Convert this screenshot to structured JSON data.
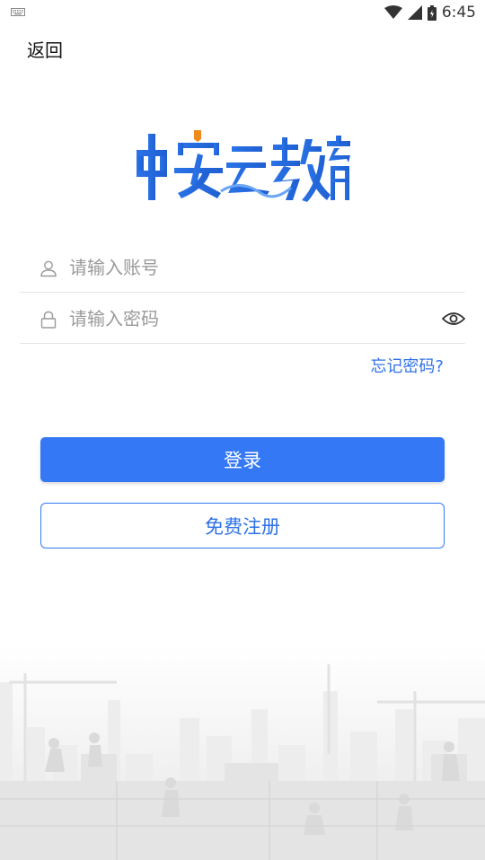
{
  "status_bar": {
    "time": "6:45"
  },
  "header": {
    "back_label": "返回"
  },
  "logo": {
    "text": "中安云教育",
    "brand_color": "#2f6fe4",
    "accent_color": "#f08a1c"
  },
  "form": {
    "account": {
      "placeholder": "请输入账号",
      "value": "",
      "icon": "user-icon"
    },
    "password": {
      "placeholder": "请输入密码",
      "value": "",
      "icon": "lock-icon",
      "toggle_icon": "eye-icon"
    },
    "forgot_label": "忘记密码?"
  },
  "buttons": {
    "login_label": "登录",
    "register_label": "免费注册"
  },
  "colors": {
    "primary": "#3478f6",
    "link": "#2f72e8"
  }
}
